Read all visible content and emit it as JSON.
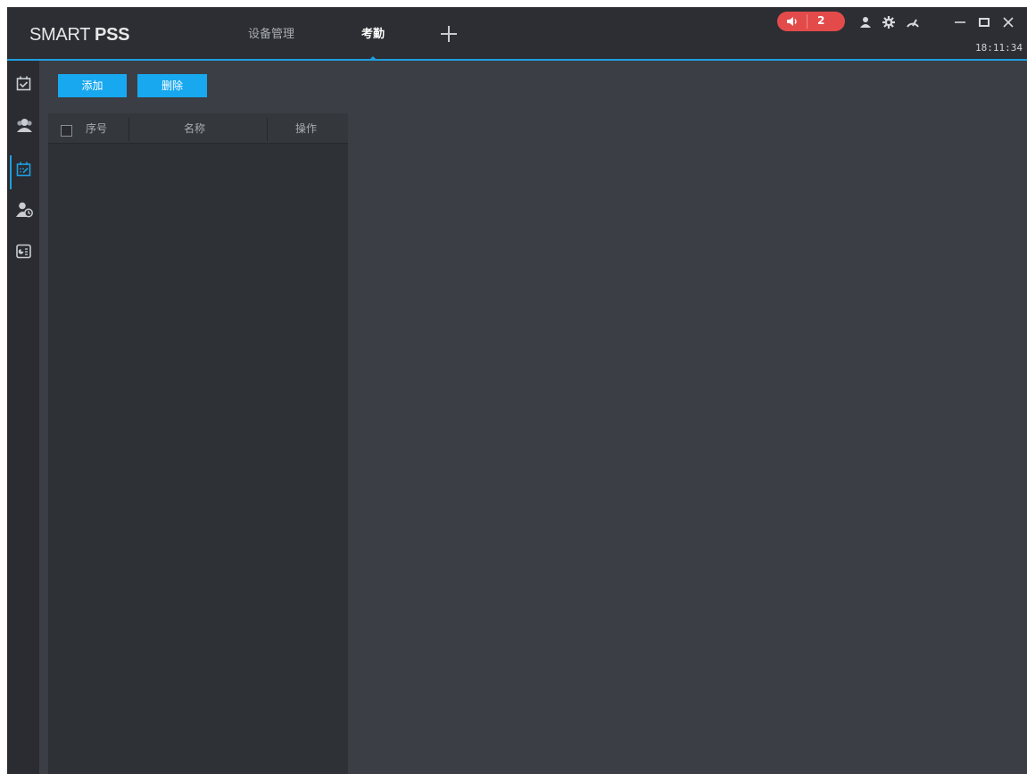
{
  "app": {
    "logo_light": "SMART ",
    "logo_bold": "PSS",
    "tabs": [
      {
        "label": "设备管理",
        "active": false
      },
      {
        "label": "考勤",
        "active": true
      }
    ],
    "alarm_count": "2",
    "clock": "18:11:34"
  },
  "toolbar": {
    "add_label": "添加",
    "delete_label": "删除"
  },
  "table": {
    "columns": [
      "序号",
      "名称",
      "操作"
    ],
    "rows": []
  },
  "sidebar": {
    "items": [
      {
        "icon": "attendance-check-icon",
        "active": false
      },
      {
        "icon": "users-icon",
        "active": false
      },
      {
        "icon": "schedule-calendar-icon",
        "active": true
      },
      {
        "icon": "user-clock-icon",
        "active": false
      },
      {
        "icon": "report-card-icon",
        "active": false
      }
    ]
  },
  "colors": {
    "accent": "#1e9fe0",
    "button": "#18a8f0",
    "alarm": "#e34b4b",
    "background": "#3b3e44",
    "titlebar": "#2c2e33"
  }
}
